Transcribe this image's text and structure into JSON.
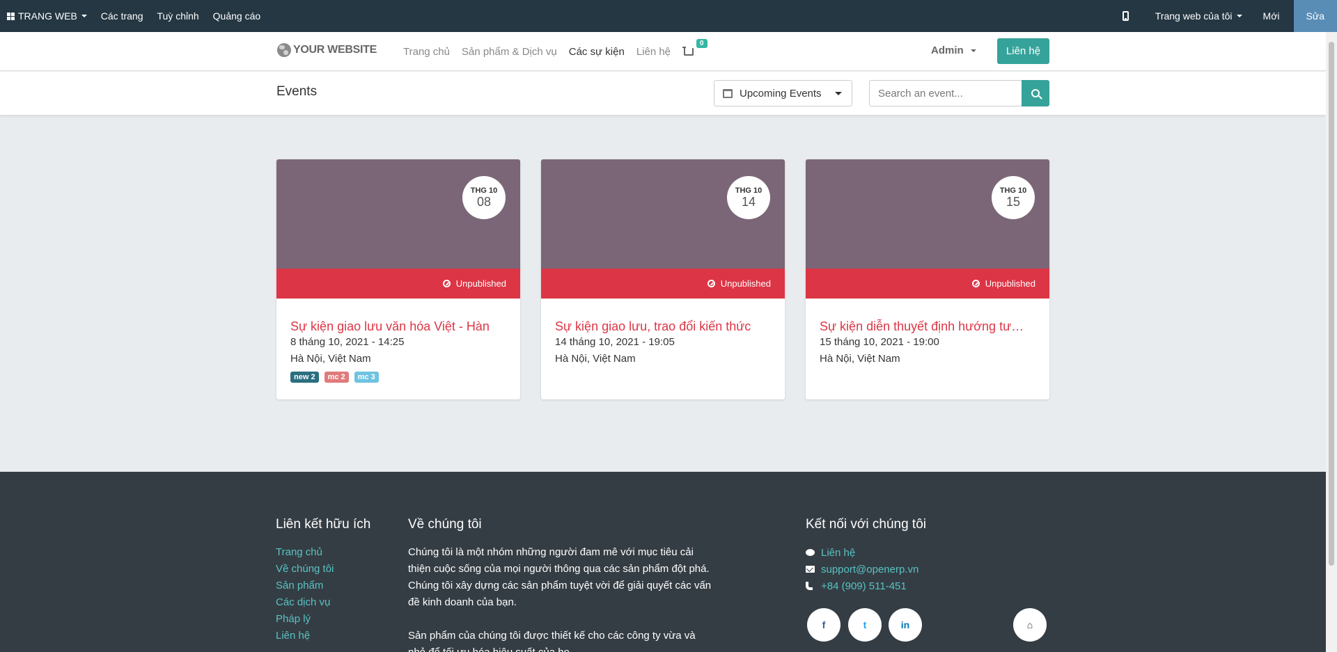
{
  "admin_bar": {
    "apps_label": "TRANG WEB",
    "menu": [
      "Các trang",
      "Tuỳ chỉnh",
      "Quảng cáo"
    ],
    "my_website": "Trang web của tôi",
    "new": "Mới",
    "edit": "Sửa"
  },
  "header": {
    "logo": "YOUR WEBSITE",
    "nav": [
      "Trang chủ",
      "Sản phẩm & Dịch vụ",
      "Các sự kiện",
      "Liên hệ"
    ],
    "active_nav": "Các sự kiện",
    "cart_count": "0",
    "user": "Admin",
    "contact_button": "Liên hệ"
  },
  "events_bar": {
    "title": "Events",
    "filter": "Upcoming Events",
    "search_placeholder": "Search an event..."
  },
  "events": [
    {
      "month": "THG 10",
      "day": "08",
      "status": "Unpublished",
      "title": "Sự kiện giao lưu văn hóa Việt - Hàn",
      "datetime": "8 tháng 10, 2021 - 14:25",
      "location": "Hà Nội, Việt Nam",
      "tags": [
        {
          "label": "new 2",
          "color": "#2a6f80"
        },
        {
          "label": "mc 2",
          "color": "#e07b7b"
        },
        {
          "label": "mc 3",
          "color": "#6fc3e0"
        }
      ]
    },
    {
      "month": "THG 10",
      "day": "14",
      "status": "Unpublished",
      "title": "Sự kiện giao lưu, trao đổi kiến thức",
      "datetime": "14 tháng 10, 2021 - 19:05",
      "location": "Hà Nội, Việt Nam",
      "tags": []
    },
    {
      "month": "THG 10",
      "day": "15",
      "status": "Unpublished",
      "title": "Sự kiện diễn thuyết định hướng tư…",
      "datetime": "15 tháng 10, 2021 - 19:00",
      "location": "Hà Nội, Việt Nam",
      "tags": []
    }
  ],
  "footer": {
    "links_title": "Liên kết hữu ích",
    "links": [
      "Trang chủ",
      "Về chúng tôi",
      "Sản phẩm",
      "Các dịch vụ",
      "Pháp lý",
      "Liên hệ"
    ],
    "about_title": "Về chúng tôi",
    "about_p1": "Chúng tôi là một nhóm những người đam mê với mục tiêu cải thiện cuộc sống của mọi người thông qua các sản phẩm đột phá. Chúng tôi xây dựng các sản phẩm tuyệt vời để giải quyết các vấn đề kinh doanh của bạn.",
    "about_p2": "Sản phẩm của chúng tôi được thiết kế cho các công ty vừa và nhỏ để tối ưu hóa hiệu suất của họ.",
    "connect_title": "Kết nối với chúng tôi",
    "contact_link": "Liên hệ",
    "email": "support@openerp.vn",
    "phone": "+84 (909) 511-451",
    "social": {
      "facebook": "f",
      "twitter": "t",
      "linkedin": "in"
    }
  },
  "colors": {
    "admin_bar": "#243743",
    "accent": "#36a39a",
    "unpublished": "#dc3545",
    "cover": "#7b6677",
    "footer": "#353d44"
  }
}
